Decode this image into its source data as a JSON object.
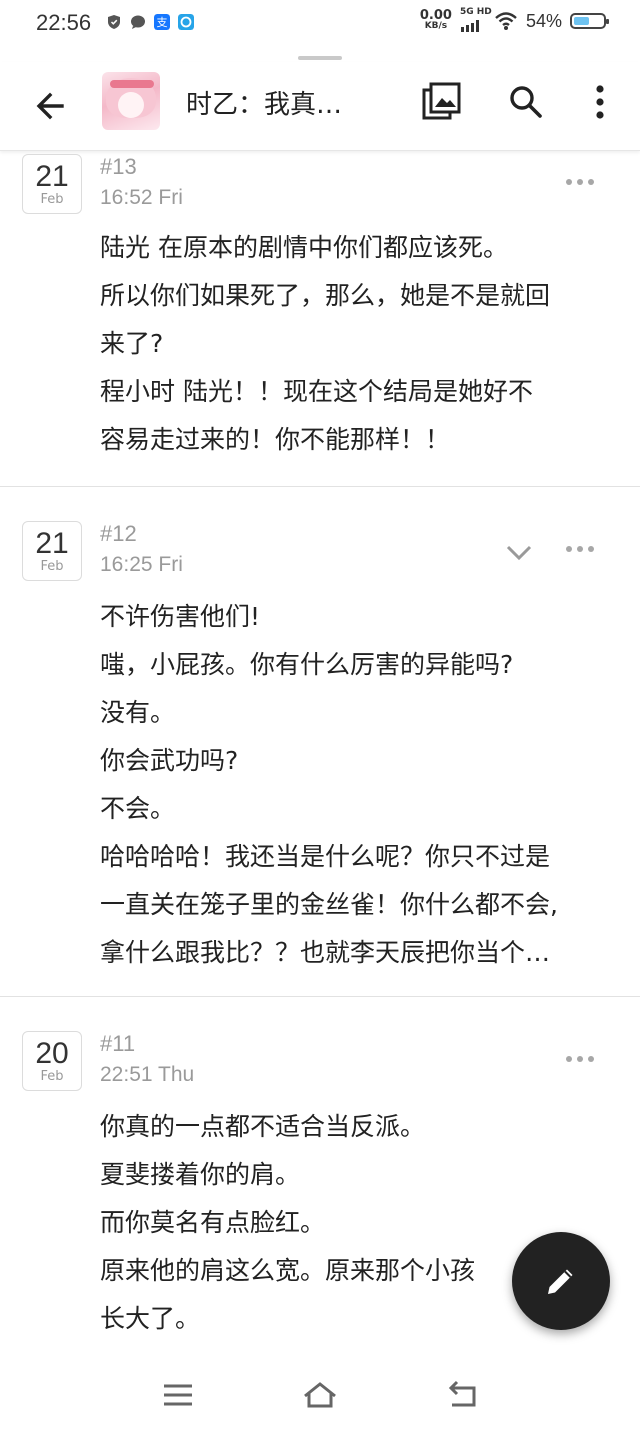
{
  "status_bar": {
    "time": "22:56",
    "speed_value": "0.00",
    "speed_unit": "KB/s",
    "network": "5G HD",
    "battery_percent": "54%",
    "battery_level": 0.54
  },
  "app_bar": {
    "title": "时乙：我真…"
  },
  "posts": [
    {
      "day": "21",
      "month": "Feb",
      "number": "#13",
      "time": "16:52 Fri",
      "lines": [
        "陆光 在原本的剧情中你们都应该死。",
        "所以你们如果死了，那么，她是不是就回",
        "来了?",
        "程小时 陆光！！现在这个结局是她好不",
        "容易走过来的！你不能那样！！"
      ]
    },
    {
      "day": "21",
      "month": "Feb",
      "number": "#12",
      "time": "16:25 Fri",
      "lines": [
        "不许伤害他们!",
        "嗤，小屁孩。你有什么厉害的异能吗?",
        "没有。",
        "你会武功吗?",
        "不会。",
        "哈哈哈哈！我还当是什么呢？你只不过是",
        "一直关在笼子里的金丝雀！你什么都不会,",
        "拿什么跟我比？？也就李天辰把你当个…"
      ]
    },
    {
      "day": "20",
      "month": "Feb",
      "number": "#11",
      "time": "22:51 Thu",
      "lines": [
        "你真的一点都不适合当反派。",
        "夏斐搂着你的肩。",
        "而你莫名有点脸红。",
        "原来他的肩这么宽。原来那个小孩",
        "长大了。"
      ]
    }
  ]
}
